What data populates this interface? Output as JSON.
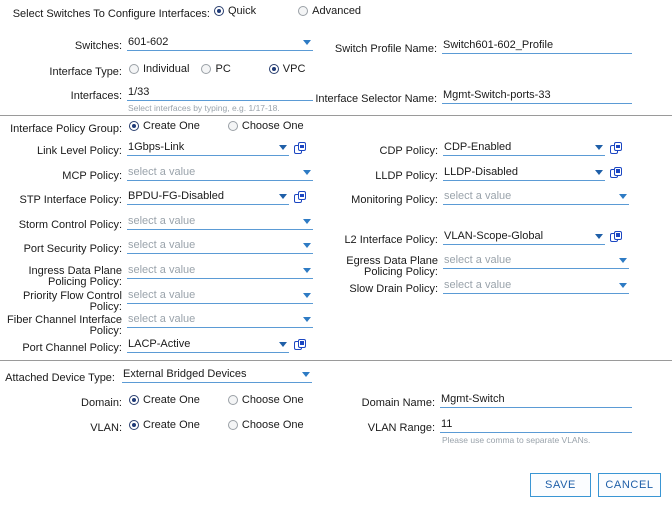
{
  "top": {
    "select_switches_label": "Select Switches To Configure Interfaces:",
    "mode_quick": "Quick",
    "mode_advanced": "Advanced",
    "switches_label": "Switches:",
    "switches_value": "601-602",
    "switch_profile_label": "Switch Profile Name:",
    "switch_profile_value": "Switch601-602_Profile",
    "interface_type_label": "Interface Type:",
    "iface_individual": "Individual",
    "iface_pc": "PC",
    "iface_vpc": "VPC",
    "interfaces_label": "Interfaces:",
    "interfaces_value": "1/33",
    "interfaces_hint": "Select interfaces by typing, e.g. 1/17-18.",
    "interface_selector_label": "Interface Selector Name:",
    "interface_selector_value": "Mgmt-Switch-ports-33"
  },
  "policy": {
    "group_label": "Interface Policy Group:",
    "create_one": "Create One",
    "choose_one": "Choose One",
    "placeholder": "select a value",
    "left": [
      {
        "label": "Link Level Policy:",
        "value": "1Gbps-Link",
        "filled": true,
        "copy": true
      },
      {
        "label": "MCP Policy:",
        "value": "select a value",
        "filled": false,
        "copy": false
      },
      {
        "label": "STP Interface Policy:",
        "value": "BPDU-FG-Disabled",
        "filled": true,
        "copy": true
      },
      {
        "label": "Storm Control Policy:",
        "value": "select a value",
        "filled": false,
        "copy": false
      },
      {
        "label": "Port Security Policy:",
        "value": "select a value",
        "filled": false,
        "copy": false
      },
      {
        "label": "Ingress Data Plane\nPolicing Policy:",
        "value": "select a value",
        "filled": false,
        "copy": false
      },
      {
        "label": "Priority Flow Control\nPolicy:",
        "value": "select a value",
        "filled": false,
        "copy": false
      },
      {
        "label": "Fiber Channel Interface\nPolicy:",
        "value": "select a value",
        "filled": false,
        "copy": false
      },
      {
        "label": "Port Channel Policy:",
        "value": "LACP-Active",
        "filled": true,
        "copy": true
      }
    ],
    "right": [
      {
        "label": "CDP Policy:",
        "value": "CDP-Enabled",
        "filled": true,
        "copy": true
      },
      {
        "label": "LLDP Policy:",
        "value": "LLDP-Disabled",
        "filled": true,
        "copy": true
      },
      {
        "label": "Monitoring Policy:",
        "value": "select a value",
        "filled": false,
        "copy": false
      },
      {
        "label": "L2 Interface Policy:",
        "value": "VLAN-Scope-Global",
        "filled": true,
        "copy": true
      },
      {
        "label": "Egress Data Plane\nPolicing Policy:",
        "value": "select a value",
        "filled": false,
        "copy": false
      },
      {
        "label": "Slow Drain Policy:",
        "value": "select a value",
        "filled": false,
        "copy": false
      }
    ]
  },
  "domain": {
    "attached_device_label": "Attached Device Type:",
    "attached_device_value": "External Bridged Devices",
    "domain_label": "Domain:",
    "vlan_label": "VLAN:",
    "create_one": "Create One",
    "choose_one": "Choose One",
    "domain_name_label": "Domain Name:",
    "domain_name_value": "Mgmt-Switch",
    "vlan_range_label": "VLAN Range:",
    "vlan_range_value": "11",
    "vlan_hint": "Please use comma to separate VLANs."
  },
  "footer": {
    "save_label": "SAVE",
    "cancel_label": "CANCEL"
  },
  "colors": {
    "accent": "#2e7bc4",
    "underline": "#5b9bd5",
    "radio_selected": "#1f3a78",
    "copy_icon": "#1b46c2",
    "placeholder": "#9aa3ab",
    "button_border": "#3a96d4",
    "button_text": "#1f5fa8"
  }
}
